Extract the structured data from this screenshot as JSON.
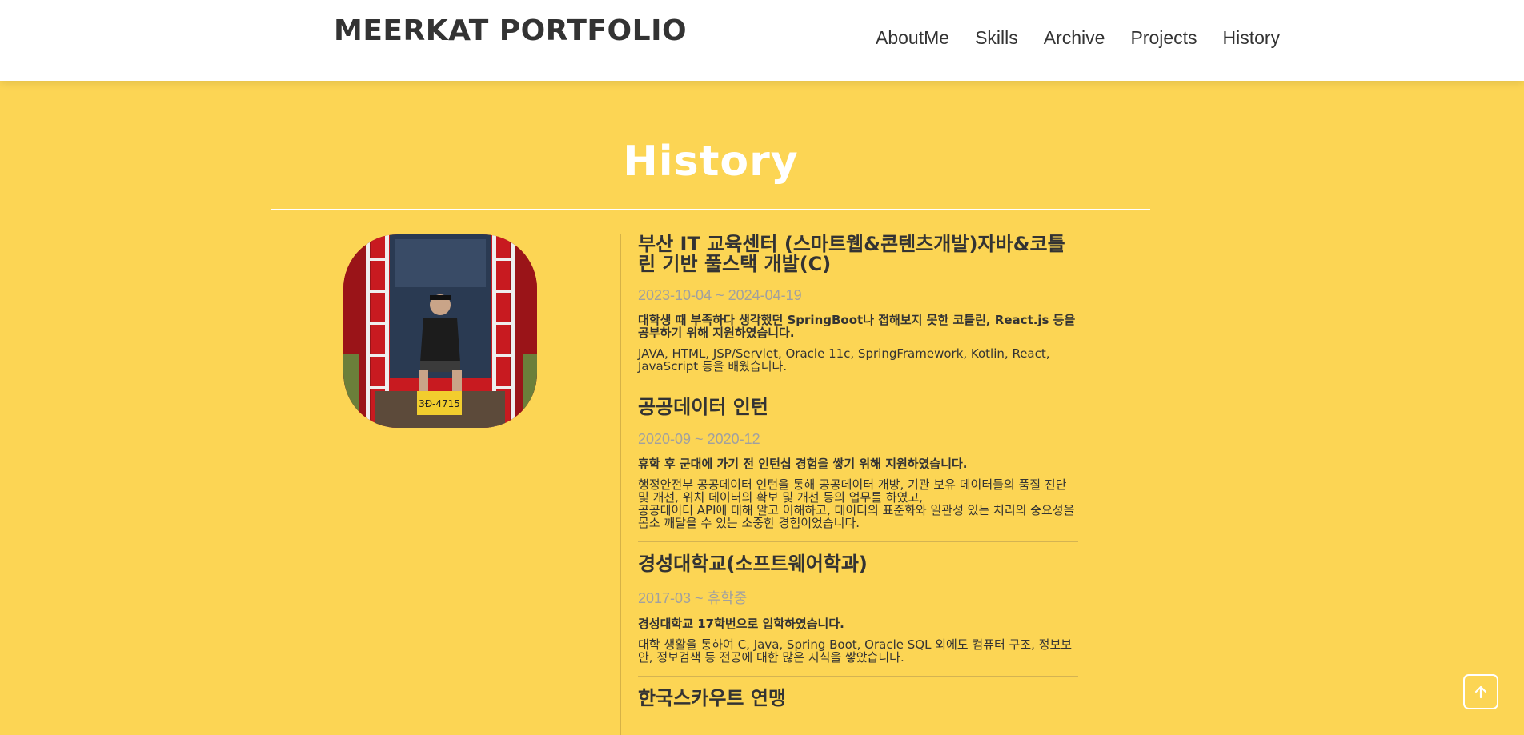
{
  "navbar": {
    "brand": "MEERKAT PORTFOLIO",
    "links": [
      "AboutMe",
      "Skills",
      "Archive",
      "Projects",
      "History"
    ]
  },
  "section": {
    "title": "History"
  },
  "colors": {
    "background": "#fcd554",
    "navbar": "#ffffff",
    "title": "#ffffff",
    "date": "#a0a0a0"
  },
  "history": [
    {
      "title": "부산 IT 교육센터 (스마트웹&콘텐츠개발)자바&코틀린 기반 풀스택 개발(C)",
      "date": "2023-10-04 ~ 2024-04-19",
      "lead": "대학생 때 부족하다 생각했던 SpringBoot나 접해보지 못한 코틀린, React.js 등을 공부하기 위해 지원하였습니다.",
      "desc": "JAVA, HTML, JSP/Servlet, Oracle 11c, SpringFramework, Kotlin, React, JavaScript 등을 배웠습니다."
    },
    {
      "title": "공공데이터 인턴",
      "date": "2020-09 ~ 2020-12",
      "lead": "휴학 후 군대에 가기 전 인턴십 경험을 쌓기 위해 지원하였습니다.",
      "desc": "행정안전부 공공데이터 인턴을 통해 공공데이터 개방, 기관 보유 데이터들의 품질 진단 및 개선, 위치 데이터의 확보 및 개선 등의 업무를 하였고,\n공공데이터 API에 대해 알고 이해하고, 데이터의 표준화와 일관성 있는 처리의 중요성을 몸소 깨달을 수 있는 소중한 경험이었습니다."
    },
    {
      "title": "경성대학교(소프트웨어학과)",
      "date": "2017-03 ~ 휴학중",
      "lead": "경성대학교 17학번으로 입학하였습니다.",
      "desc": "대학 생활을 통하여 C, Java, Spring Boot, Oracle SQL 외에도 컴퓨터 구조, 정보보안, 정보검색 등 전공에 대한 많은 지식을 쌓았습니다."
    },
    {
      "title": "한국스카우트 연맹",
      "date": "",
      "lead": "",
      "desc": ""
    }
  ],
  "photo": {
    "plate_text": "3Ð-4715"
  },
  "icons": {
    "scroll_top": "arrow-up-icon"
  }
}
